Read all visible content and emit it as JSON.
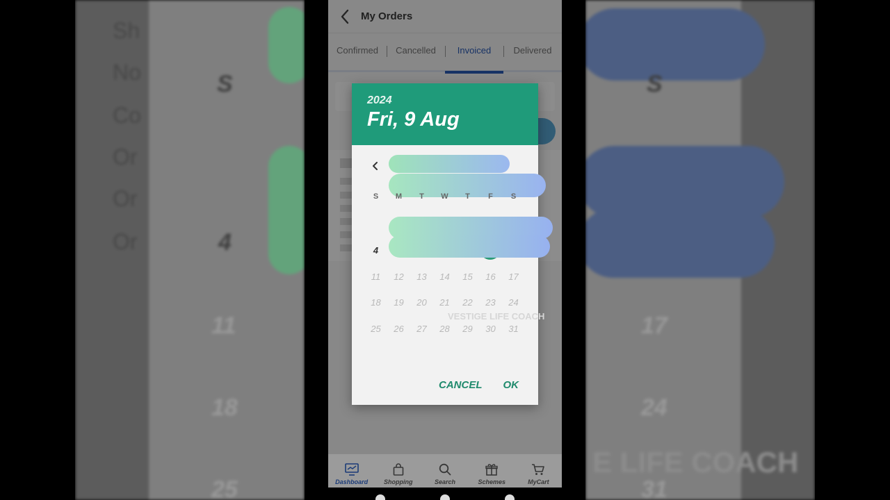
{
  "header": {
    "title": "My Orders"
  },
  "tabs": [
    {
      "label": "Confirmed"
    },
    {
      "label": "Cancelled"
    },
    {
      "label": "Invoiced",
      "active": true
    },
    {
      "label": "Delivered"
    }
  ],
  "dialog": {
    "year": "2024",
    "selected_date": "Fri, 9 Aug",
    "weekdays": [
      "S",
      "M",
      "T",
      "W",
      "T",
      "F",
      "S"
    ],
    "visible_week_start": "4",
    "weeks": [
      [
        "11",
        "12",
        "13",
        "14",
        "15",
        "16",
        "17"
      ],
      [
        "18",
        "19",
        "20",
        "21",
        "22",
        "23",
        "24"
      ],
      [
        "25",
        "26",
        "27",
        "28",
        "29",
        "30",
        "31"
      ]
    ],
    "cancel_label": "CANCEL",
    "ok_label": "OK",
    "watermark": "VESTIGE LIFE COACH"
  },
  "bottom_nav": [
    {
      "label": "Dashboard",
      "icon": "dashboard-icon",
      "active": true
    },
    {
      "label": "Shopping",
      "icon": "shopping-bag-icon"
    },
    {
      "label": "Search",
      "icon": "search-icon"
    },
    {
      "label": "Schemes",
      "icon": "gift-icon"
    },
    {
      "label": "MyCart",
      "icon": "cart-icon"
    }
  ],
  "background_zoom": {
    "weekday_letter": "S",
    "day": "4",
    "row_a": [
      "11",
      "17"
    ],
    "row_b": [
      "18",
      "24"
    ],
    "row_c": [
      "25",
      "31"
    ],
    "watermark_fragment": "E LIFE COACH"
  },
  "colors": {
    "accent": "#1f9b7a",
    "tab_active": "#2a5bb8",
    "dialog_bg": "#f2f2f2"
  }
}
